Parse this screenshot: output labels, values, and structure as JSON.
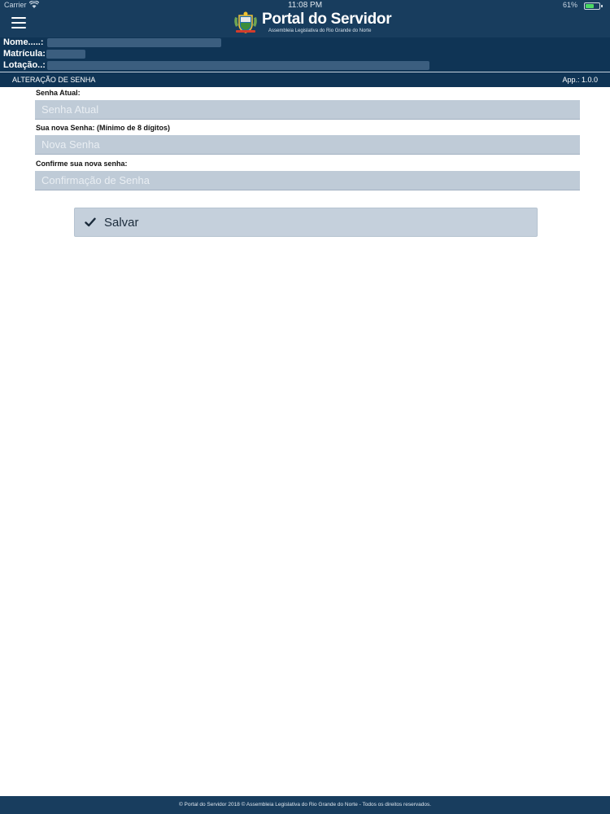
{
  "status_bar": {
    "carrier": "Carrier",
    "time": "11:08 PM",
    "battery": "61%",
    "battery_level": 0.61
  },
  "header": {
    "title": "Portal do Servidor",
    "subtitle": "Assembleia Legislativa do Rio Grande do Norte"
  },
  "user_info": {
    "nome_label": "Nome.....:",
    "matricula_label": "Matrícula:",
    "lotacao_label": "Lotação..:"
  },
  "section": {
    "title": "ALTERAÇÃO DE SENHA",
    "app_version": "App.: 1.0.0"
  },
  "form": {
    "current_label": "Senha Atual:",
    "current_placeholder": "Senha Atual",
    "new_label": "Sua nova Senha: (Mínimo de 8 dígitos)",
    "new_placeholder": "Nova Senha",
    "confirm_label": "Confirme sua nova senha:",
    "confirm_placeholder": "Confirmação de Senha",
    "save_label": "Salvar"
  },
  "footer": {
    "text": "© Portal do Servidor 2018 © Assembleia Legislativa do Rio Grande do Norte - Todos os direitos reservados."
  },
  "colors": {
    "header_bg": "#183d5e",
    "info_bg": "#0f3455",
    "field_bg": "#bfcbd7",
    "button_bg": "#c5d0dc"
  }
}
